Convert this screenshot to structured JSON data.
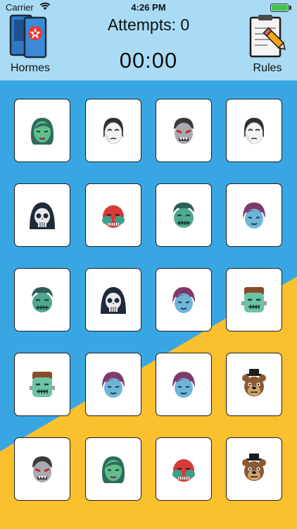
{
  "status": {
    "carrier": "Carrier",
    "time": "4:26 PM",
    "battery_level": 1.0
  },
  "header": {
    "attempts_label": "Attempts: 0",
    "timer": "00:00",
    "left_button_label": "Hormes",
    "right_button_label": "Rules"
  },
  "colors": {
    "header_bg": "#a9dbf4",
    "board_blue": "#39a6e4",
    "board_yellow": "#fbc02d",
    "card_border": "#1d1d1d"
  },
  "cards": [
    "green-woman-face",
    "white-mask-face",
    "grey-vampire-face",
    "white-mask-face",
    "skull-hood-face",
    "red-masked-face",
    "green-zombie-face",
    "purple-hair-face",
    "green-zombie-face",
    "skull-hood-face",
    "purple-hair-face",
    "frankenstein-face",
    "frankenstein-face",
    "purple-hair-face",
    "purple-hair-face",
    "freddy-bear-face",
    "grey-vampire-face",
    "green-woman-face",
    "red-masked-face",
    "freddy-bear-face"
  ]
}
